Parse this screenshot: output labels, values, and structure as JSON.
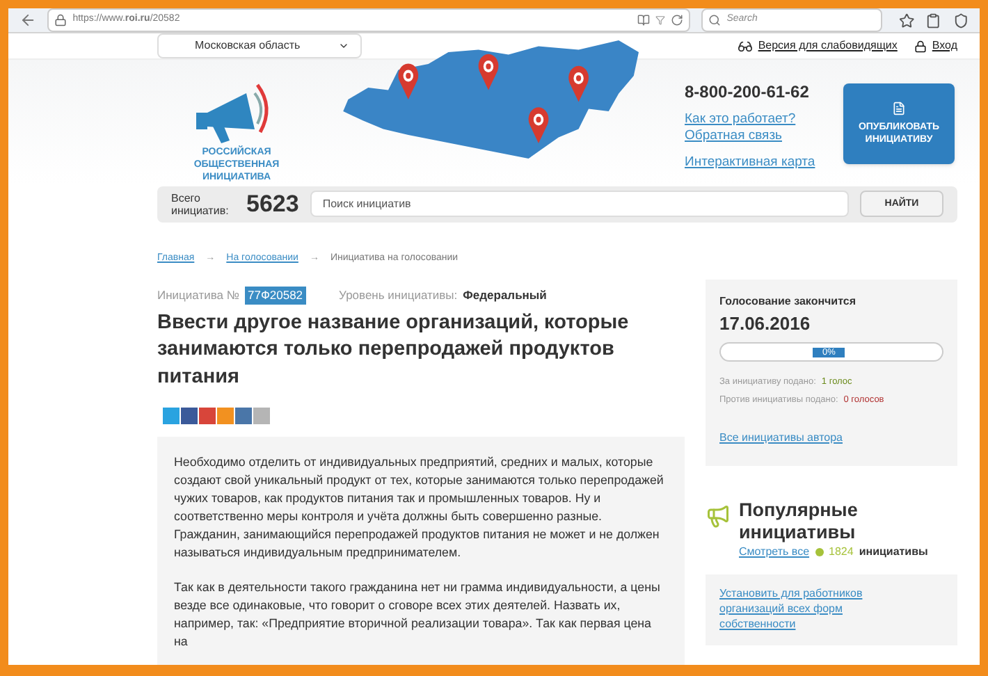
{
  "browser": {
    "url": "https://www.**roi.ru**/20582",
    "search_placeholder": "Search"
  },
  "top_bar": {
    "region": "Московская область",
    "accessibility_link": "Версия для слабовидящих",
    "login_link": "Вход"
  },
  "header": {
    "logo_text": "РОССИЙСКАЯ ОБЩЕСТВЕННАЯ ИНИЦИАТИВА",
    "phone": "8-800-200-61-62",
    "links": [
      "Как это работает?",
      "Обратная связь",
      "Интерактивная карта"
    ],
    "publish_button": "ОПУБЛИКОВАТЬ ИНИЦИАТИВУ"
  },
  "search": {
    "total_label": "Всего инициатив:",
    "total": "5623",
    "placeholder": "Поиск инициатив",
    "button": "НАЙТИ"
  },
  "breadcrumb": [
    {
      "kind": "link",
      "text": "Главная"
    },
    {
      "kind": "separator",
      "text": "→"
    },
    {
      "kind": "link",
      "text": "На голосовании"
    },
    {
      "kind": "separator",
      "text": "→"
    },
    {
      "kind": "current",
      "text": "Инициатива на голосовании"
    }
  ],
  "initiative": {
    "number_label": "Инициатива №",
    "number": "77Ф20582",
    "level_label": "Уровень инициативы:",
    "level_value": "Федеральный",
    "title": "Ввести другое название организаций, которые занимаются только перепродажей продуктов питания",
    "paragraphs": [
      "Необходимо отделить от индивидуальных предприятий, средних и малых, которые создают свой уникальный продукт от тех, которые занимаются только перепродажей чужих товаров, как продуктов питания так и промышленных товаров. Ну и соответственно меры контроля и учёта должны быть совершенно разные. Гражданин, занимающийся перепродажей продуктов питания не может и не должен называться индивидуальным предпринимателем.",
      "Так как в деятельности такого гражданина нет ни грамма индивидуальности, а цены везде все одинаковые, что говорит о сговоре всех этих деятелей. Назвать их, например, так: «Предприятие вторичной реализации товара». Так как первая цена на"
    ]
  },
  "voting": {
    "label": "Голосование закончится",
    "date": "17.06.2016",
    "reading": "0%",
    "for_label": "За инициативу подано:",
    "for_count": "1 голос",
    "against_label": "Против инициативы подано:",
    "against_count": "0 голосов",
    "author_link": "Все инициативы автора"
  },
  "popular": {
    "title": "Популярные инициативы",
    "see_all": "Смотреть все",
    "count": "1824",
    "count_label": "инициативы",
    "items": [
      "Установить для работников организаций всех форм собственности"
    ]
  }
}
